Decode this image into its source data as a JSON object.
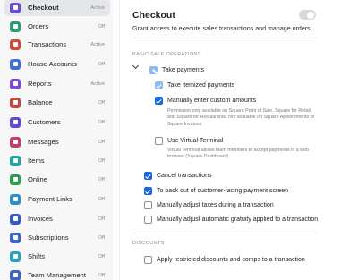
{
  "sidebar": {
    "items": [
      {
        "label": "Checkout",
        "status": "Active",
        "color": "#6a4bd6",
        "icon": "checkout-icon"
      },
      {
        "label": "Orders",
        "status": "Off",
        "color": "#2a9d73",
        "icon": "orders-icon"
      },
      {
        "label": "Transactions",
        "status": "Active",
        "color": "#d14b3a",
        "icon": "transactions-icon"
      },
      {
        "label": "House Accounts",
        "status": "Off",
        "color": "#3f6fd8",
        "icon": "house-accounts-icon"
      },
      {
        "label": "Reports",
        "status": "Active",
        "color": "#7a4bd1",
        "icon": "reports-icon"
      },
      {
        "label": "Balance",
        "status": "Off",
        "color": "#c64646",
        "icon": "balance-icon"
      },
      {
        "label": "Customers",
        "status": "Off",
        "color": "#6048d4",
        "icon": "customers-icon"
      },
      {
        "label": "Messages",
        "status": "Off",
        "color": "#c43a6a",
        "icon": "messages-icon"
      },
      {
        "label": "Items",
        "status": "Off",
        "color": "#1ea7a1",
        "icon": "items-icon"
      },
      {
        "label": "Online",
        "status": "Off",
        "color": "#2b9e4e",
        "icon": "online-icon"
      },
      {
        "label": "Payment Links",
        "status": "Off",
        "color": "#2c8dcc",
        "icon": "payment-links-icon"
      },
      {
        "label": "Invoices",
        "status": "Off",
        "color": "#3559c9",
        "icon": "invoices-icon"
      },
      {
        "label": "Subscriptions",
        "status": "Off",
        "color": "#3b66d1",
        "icon": "subscriptions-icon"
      },
      {
        "label": "Shifts",
        "status": "Off",
        "color": "#2aa0c0",
        "icon": "shifts-icon"
      },
      {
        "label": "Team Management",
        "status": "Off",
        "color": "#3e63c9",
        "icon": "team-management-icon"
      }
    ]
  },
  "main": {
    "title": "Checkout",
    "description": "Grant access to execute sales transactions and manage orders.",
    "toggle_on": false,
    "section_basic": "BASIC SALE OPERATIONS",
    "section_discounts": "DISCOUNTS",
    "take_payments": {
      "label": "Take payments",
      "state": "partial"
    },
    "take_itemized": {
      "label": "Take itemized payments",
      "state": "checked-disabled"
    },
    "custom_amounts": {
      "label": "Manually enter custom amounts",
      "state": "checked",
      "help": "Permission only available on Square Point of Sale, Square for Retail, and Square for Restaurants. Not available on Square Appointments or Square Invoices."
    },
    "virtual_terminal": {
      "label": "Use Virtual Terminal",
      "state": "unchecked",
      "help": "Virtual Terminal allows team members to accept payments in a web browser (Square Dashboard)."
    },
    "cancel_transactions": {
      "label": "Cancel transactions",
      "state": "checked"
    },
    "back_out": {
      "label": "To back out of customer-facing payment screen",
      "state": "checked"
    },
    "adjust_taxes": {
      "label": "Manually adjust taxes during a transaction",
      "state": "unchecked"
    },
    "adjust_gratuity": {
      "label": "Manually adjust automatic gratuity applied to a transaction",
      "state": "unchecked"
    },
    "restricted_discounts": {
      "label": "Apply restricted discounts and comps to a transaction",
      "state": "unchecked"
    },
    "accent_color": "#1368e3"
  }
}
